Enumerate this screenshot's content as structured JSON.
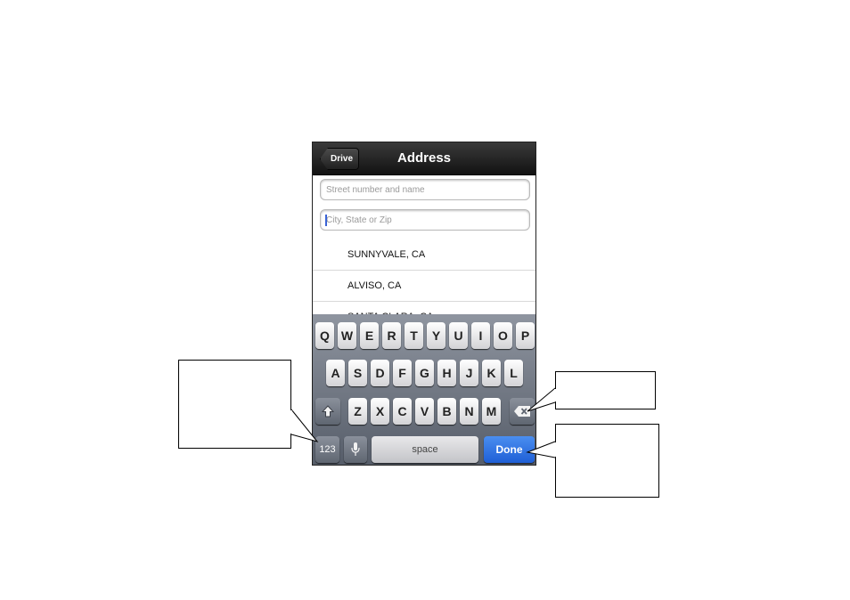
{
  "navbar": {
    "back_label": "Drive",
    "title": "Address"
  },
  "fields": {
    "street_placeholder": "Street number and name",
    "city_placeholder": "City, State or Zip"
  },
  "suggestions": [
    "SUNNYVALE, CA",
    "ALVISO, CA",
    "SANTA CLARA, CA"
  ],
  "keyboard": {
    "row1": [
      "Q",
      "W",
      "E",
      "R",
      "T",
      "Y",
      "U",
      "I",
      "O",
      "P"
    ],
    "row2": [
      "A",
      "S",
      "D",
      "F",
      "G",
      "H",
      "J",
      "K",
      "L"
    ],
    "row3": [
      "Z",
      "X",
      "C",
      "V",
      "B",
      "N",
      "M"
    ],
    "numbers_label": "123",
    "space_label": "space",
    "done_label": "Done",
    "shift_icon": "shift-icon",
    "mic_icon": "microphone-icon",
    "backspace_icon": "backspace-icon"
  },
  "colors": {
    "accent_blue": "#2a6ae0",
    "caret": "#3a63d6"
  }
}
